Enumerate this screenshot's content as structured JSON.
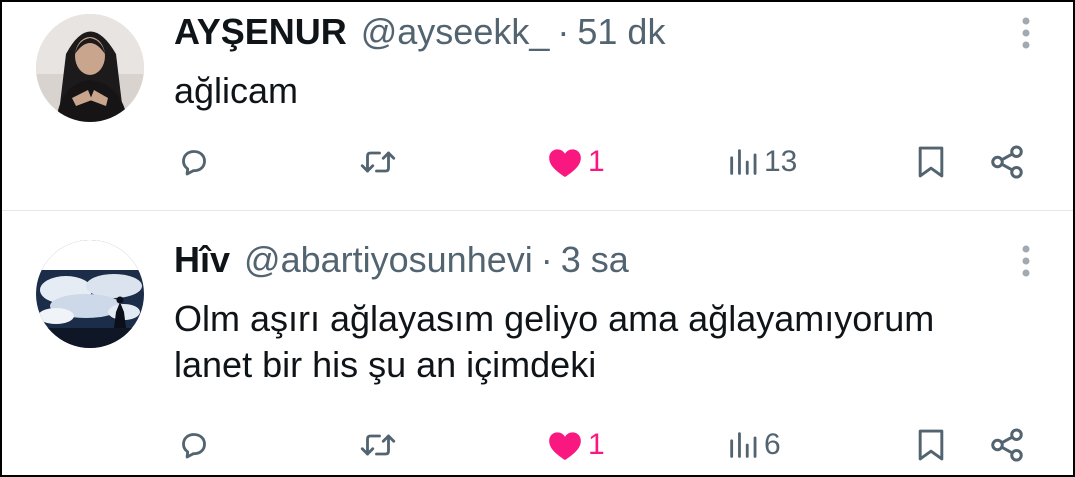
{
  "tweets": [
    {
      "name": "AYŞENUR",
      "handle": "@ayseekk_",
      "separator": "·",
      "time": "51 dk",
      "text_lines": [
        "ağlicam"
      ],
      "likes": "1",
      "views": "13"
    },
    {
      "name": "Hîv",
      "handle": "@abartiyosunhevi",
      "separator": "·",
      "time": "3 sa",
      "text_lines": [
        "Olm aşırı ağlayasım geliyo ama ağlayamıyorum",
        "lanet bir his şu an içimdeki"
      ],
      "likes": "1",
      "views": "6"
    }
  ],
  "icons": {
    "reply": "reply-icon",
    "retweet": "retweet-icon",
    "like": "heart-filled-icon",
    "views": "views-icon",
    "bookmark": "bookmark-icon",
    "share": "share-icon",
    "more": "more-vertical-icon"
  },
  "colors": {
    "text": "#0f1419",
    "muted": "#536471",
    "like": "#f91880",
    "divider": "#e4e8ea"
  }
}
